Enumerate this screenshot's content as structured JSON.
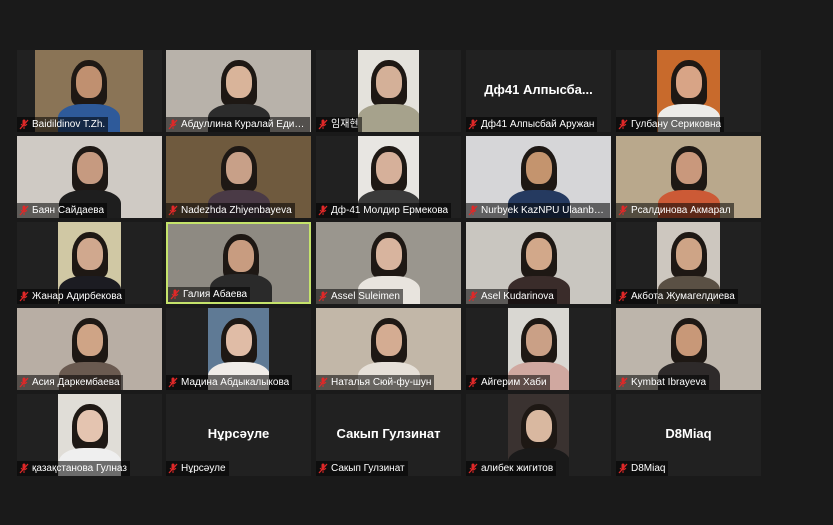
{
  "colors": {
    "background": "#1a1a1a",
    "tile": "#212121",
    "active_speaker_border": "#c5e36b",
    "muted_icon": "#e02828"
  },
  "participants": [
    {
      "label": "Baidildinov T.Zh.",
      "video": true
    },
    {
      "label": "Абдуллина Куралай Едило...",
      "video": true
    },
    {
      "label": "임재현",
      "video": true
    },
    {
      "label": "Дф41 Алпысбай Аружан",
      "video": false,
      "display_name": "Дф41 Алпысба..."
    },
    {
      "label": "Гулбану Сериковна",
      "video": true
    },
    {
      "label": "Баян Сайдаева",
      "video": true
    },
    {
      "label": "Nadezhda Zhiyenbayeva",
      "video": true
    },
    {
      "label": "Дф-41 Молдир Ермекова",
      "video": true
    },
    {
      "label": "Nurbyek KazNPU Ulaanba...",
      "video": true
    },
    {
      "label": "Рсалдинова Акмарал",
      "video": true
    },
    {
      "label": "Жанар Адирбекова",
      "video": true
    },
    {
      "label": "Галия Абаева",
      "video": true,
      "active_speaker": true
    },
    {
      "label": "Assel Suleimen",
      "video": true
    },
    {
      "label": "Asel Kudarinova",
      "video": true
    },
    {
      "label": "Акбота Жумагелдиева",
      "video": true
    },
    {
      "label": "Асия Даркембаева",
      "video": true
    },
    {
      "label": "Мадина Абдыкалыкова",
      "video": true
    },
    {
      "label": "Наталья Сюй-фу-шун",
      "video": true
    },
    {
      "label": "Айгерим Хаби",
      "video": true
    },
    {
      "label": "Kymbat Ibrayeva",
      "video": true
    },
    {
      "label": "қазақстанова Гулназ",
      "video": true
    },
    {
      "label": "Нұрсәуле",
      "video": false,
      "display_name": "Нұрсәуле"
    },
    {
      "label": "Сакып Гулзинат",
      "video": false,
      "display_name": "Сакып Гулзинат"
    },
    {
      "label": "алибек жигитов",
      "video": true
    },
    {
      "label": "D8Miaq",
      "video": false,
      "display_name": "D8Miaq"
    }
  ],
  "icons": {
    "muted": "microphone-muted-icon"
  }
}
